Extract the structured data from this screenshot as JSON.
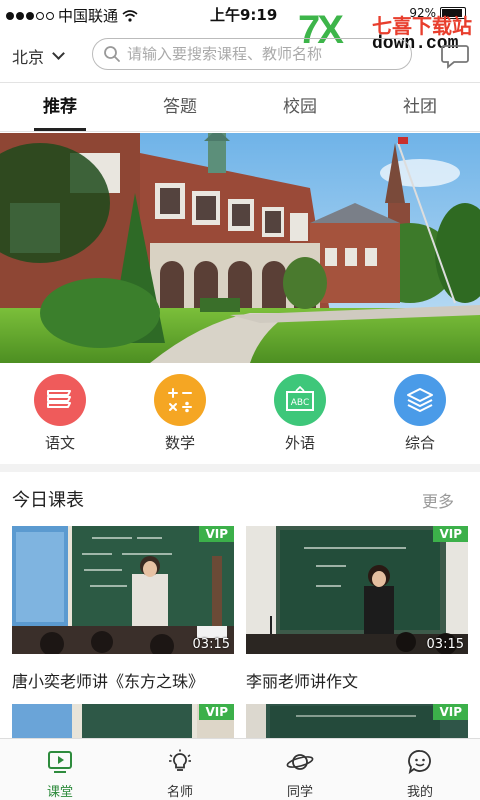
{
  "status_bar": {
    "carrier": "中国联通",
    "time": "上午9:19",
    "battery": "92%"
  },
  "watermark": {
    "logo": "7X",
    "top": "七喜下载站",
    "bottom": "down.com"
  },
  "header": {
    "city": "北京",
    "search_placeholder": "请输入要搜索课程、教师名称"
  },
  "tabs": [
    {
      "label": "推荐",
      "active": true
    },
    {
      "label": "答题",
      "active": false
    },
    {
      "label": "校园",
      "active": false
    },
    {
      "label": "社团",
      "active": false
    }
  ],
  "categories": [
    {
      "label": "语文",
      "icon": "books-icon",
      "color": "#ef5b5b"
    },
    {
      "label": "数学",
      "icon": "math-operators-icon",
      "color": "#f5a623"
    },
    {
      "label": "外语",
      "icon": "abc-board-icon",
      "color": "#3ec77a"
    },
    {
      "label": "综合",
      "icon": "layers-icon",
      "color": "#4a9be8"
    }
  ],
  "today": {
    "title": "今日课表",
    "more": "更多",
    "courses": [
      {
        "title": "唐小奕老师讲《东方之珠》",
        "vip": "VIP",
        "duration": "03:15"
      },
      {
        "title": "李丽老师讲作文",
        "vip": "VIP",
        "duration": "03:15"
      },
      {
        "title": "",
        "vip": "VIP",
        "duration": ""
      },
      {
        "title": "",
        "vip": "VIP",
        "duration": ""
      }
    ]
  },
  "bottom_nav": [
    {
      "label": "课堂",
      "icon": "play-screen-icon",
      "active": true
    },
    {
      "label": "名师",
      "icon": "lightbulb-icon",
      "active": false
    },
    {
      "label": "同学",
      "icon": "planet-icon",
      "active": false
    },
    {
      "label": "我的",
      "icon": "smiley-chat-icon",
      "active": false
    }
  ],
  "colors": {
    "accent": "#2e8b3d",
    "vip": "#3cb04a"
  }
}
